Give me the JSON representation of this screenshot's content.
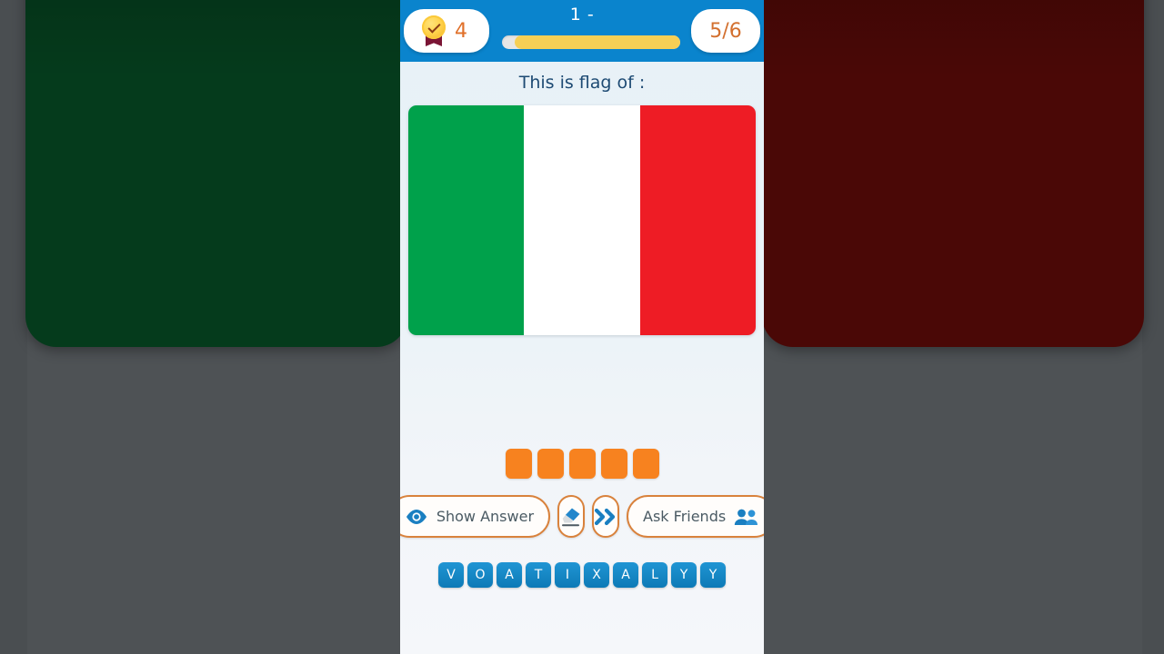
{
  "app": {
    "background_color": "#4e5255",
    "screen_bg_top": "#e7f1f7",
    "screen_bg_bottom": "#f5f7fa"
  },
  "backdrop": {
    "left_color": "#053b1c",
    "right_color": "#4a0806"
  },
  "topbar": {
    "bg_color": "#0a84cd",
    "score_icon": "medal-icon",
    "score_value": "4",
    "level_label": "1 -",
    "question_counter": "5/6",
    "progress": {
      "percent": 93,
      "fill_color": "#f6cf55",
      "track_color": "#e6e6e6"
    }
  },
  "main": {
    "question_text": "This is flag of :",
    "flag": {
      "name": "italy-flag",
      "stripes": [
        "#00a14b",
        "#ffffff",
        "#ee1c25"
      ]
    },
    "answer_slots": {
      "count": 5,
      "color": "#f7821f",
      "values": [
        "",
        "",
        "",
        "",
        ""
      ]
    }
  },
  "actions": [
    {
      "id": "show-answer",
      "label": "Show Answer",
      "icon": "eye-icon",
      "type": "wide"
    },
    {
      "id": "erase",
      "label": "",
      "icon": "eraser-icon",
      "type": "round"
    },
    {
      "id": "skip",
      "label": "",
      "icon": "double-chevron-right-icon",
      "type": "round"
    },
    {
      "id": "ask-friends",
      "label": "Ask Friends",
      "icon": "friends-icon",
      "type": "wide"
    }
  ],
  "keyboard": {
    "letters": [
      "V",
      "O",
      "A",
      "T",
      "I",
      "X",
      "A",
      "L",
      "Y",
      "Y"
    ],
    "key_color": "#1288ca"
  }
}
